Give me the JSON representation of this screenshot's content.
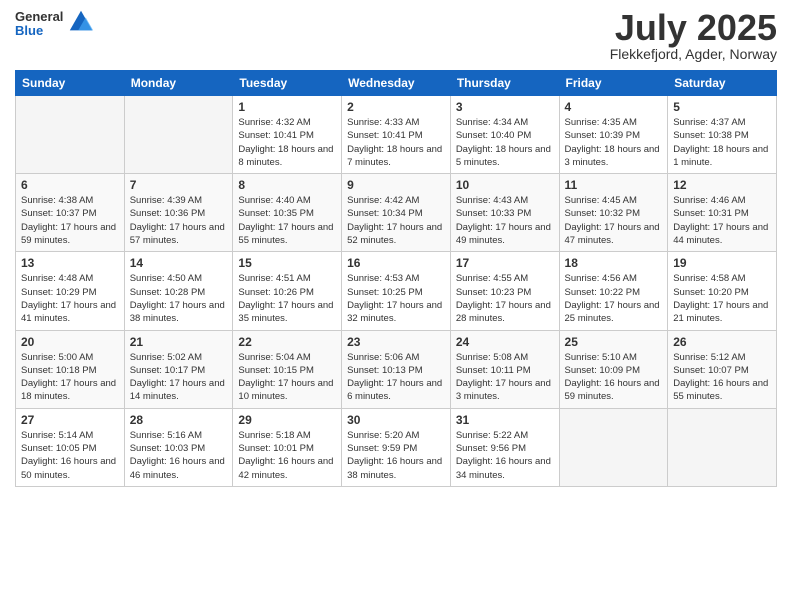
{
  "header": {
    "logo": {
      "general": "General",
      "blue": "Blue"
    },
    "title": "July 2025",
    "location": "Flekkefjord, Agder, Norway"
  },
  "calendar": {
    "weekdays": [
      "Sunday",
      "Monday",
      "Tuesday",
      "Wednesday",
      "Thursday",
      "Friday",
      "Saturday"
    ],
    "weeks": [
      [
        {
          "day": "",
          "info": ""
        },
        {
          "day": "",
          "info": ""
        },
        {
          "day": "1",
          "info": "Sunrise: 4:32 AM\nSunset: 10:41 PM\nDaylight: 18 hours and 8 minutes."
        },
        {
          "day": "2",
          "info": "Sunrise: 4:33 AM\nSunset: 10:41 PM\nDaylight: 18 hours and 7 minutes."
        },
        {
          "day": "3",
          "info": "Sunrise: 4:34 AM\nSunset: 10:40 PM\nDaylight: 18 hours and 5 minutes."
        },
        {
          "day": "4",
          "info": "Sunrise: 4:35 AM\nSunset: 10:39 PM\nDaylight: 18 hours and 3 minutes."
        },
        {
          "day": "5",
          "info": "Sunrise: 4:37 AM\nSunset: 10:38 PM\nDaylight: 18 hours and 1 minute."
        }
      ],
      [
        {
          "day": "6",
          "info": "Sunrise: 4:38 AM\nSunset: 10:37 PM\nDaylight: 17 hours and 59 minutes."
        },
        {
          "day": "7",
          "info": "Sunrise: 4:39 AM\nSunset: 10:36 PM\nDaylight: 17 hours and 57 minutes."
        },
        {
          "day": "8",
          "info": "Sunrise: 4:40 AM\nSunset: 10:35 PM\nDaylight: 17 hours and 55 minutes."
        },
        {
          "day": "9",
          "info": "Sunrise: 4:42 AM\nSunset: 10:34 PM\nDaylight: 17 hours and 52 minutes."
        },
        {
          "day": "10",
          "info": "Sunrise: 4:43 AM\nSunset: 10:33 PM\nDaylight: 17 hours and 49 minutes."
        },
        {
          "day": "11",
          "info": "Sunrise: 4:45 AM\nSunset: 10:32 PM\nDaylight: 17 hours and 47 minutes."
        },
        {
          "day": "12",
          "info": "Sunrise: 4:46 AM\nSunset: 10:31 PM\nDaylight: 17 hours and 44 minutes."
        }
      ],
      [
        {
          "day": "13",
          "info": "Sunrise: 4:48 AM\nSunset: 10:29 PM\nDaylight: 17 hours and 41 minutes."
        },
        {
          "day": "14",
          "info": "Sunrise: 4:50 AM\nSunset: 10:28 PM\nDaylight: 17 hours and 38 minutes."
        },
        {
          "day": "15",
          "info": "Sunrise: 4:51 AM\nSunset: 10:26 PM\nDaylight: 17 hours and 35 minutes."
        },
        {
          "day": "16",
          "info": "Sunrise: 4:53 AM\nSunset: 10:25 PM\nDaylight: 17 hours and 32 minutes."
        },
        {
          "day": "17",
          "info": "Sunrise: 4:55 AM\nSunset: 10:23 PM\nDaylight: 17 hours and 28 minutes."
        },
        {
          "day": "18",
          "info": "Sunrise: 4:56 AM\nSunset: 10:22 PM\nDaylight: 17 hours and 25 minutes."
        },
        {
          "day": "19",
          "info": "Sunrise: 4:58 AM\nSunset: 10:20 PM\nDaylight: 17 hours and 21 minutes."
        }
      ],
      [
        {
          "day": "20",
          "info": "Sunrise: 5:00 AM\nSunset: 10:18 PM\nDaylight: 17 hours and 18 minutes."
        },
        {
          "day": "21",
          "info": "Sunrise: 5:02 AM\nSunset: 10:17 PM\nDaylight: 17 hours and 14 minutes."
        },
        {
          "day": "22",
          "info": "Sunrise: 5:04 AM\nSunset: 10:15 PM\nDaylight: 17 hours and 10 minutes."
        },
        {
          "day": "23",
          "info": "Sunrise: 5:06 AM\nSunset: 10:13 PM\nDaylight: 17 hours and 6 minutes."
        },
        {
          "day": "24",
          "info": "Sunrise: 5:08 AM\nSunset: 10:11 PM\nDaylight: 17 hours and 3 minutes."
        },
        {
          "day": "25",
          "info": "Sunrise: 5:10 AM\nSunset: 10:09 PM\nDaylight: 16 hours and 59 minutes."
        },
        {
          "day": "26",
          "info": "Sunrise: 5:12 AM\nSunset: 10:07 PM\nDaylight: 16 hours and 55 minutes."
        }
      ],
      [
        {
          "day": "27",
          "info": "Sunrise: 5:14 AM\nSunset: 10:05 PM\nDaylight: 16 hours and 50 minutes."
        },
        {
          "day": "28",
          "info": "Sunrise: 5:16 AM\nSunset: 10:03 PM\nDaylight: 16 hours and 46 minutes."
        },
        {
          "day": "29",
          "info": "Sunrise: 5:18 AM\nSunset: 10:01 PM\nDaylight: 16 hours and 42 minutes."
        },
        {
          "day": "30",
          "info": "Sunrise: 5:20 AM\nSunset: 9:59 PM\nDaylight: 16 hours and 38 minutes."
        },
        {
          "day": "31",
          "info": "Sunrise: 5:22 AM\nSunset: 9:56 PM\nDaylight: 16 hours and 34 minutes."
        },
        {
          "day": "",
          "info": ""
        },
        {
          "day": "",
          "info": ""
        }
      ]
    ]
  }
}
